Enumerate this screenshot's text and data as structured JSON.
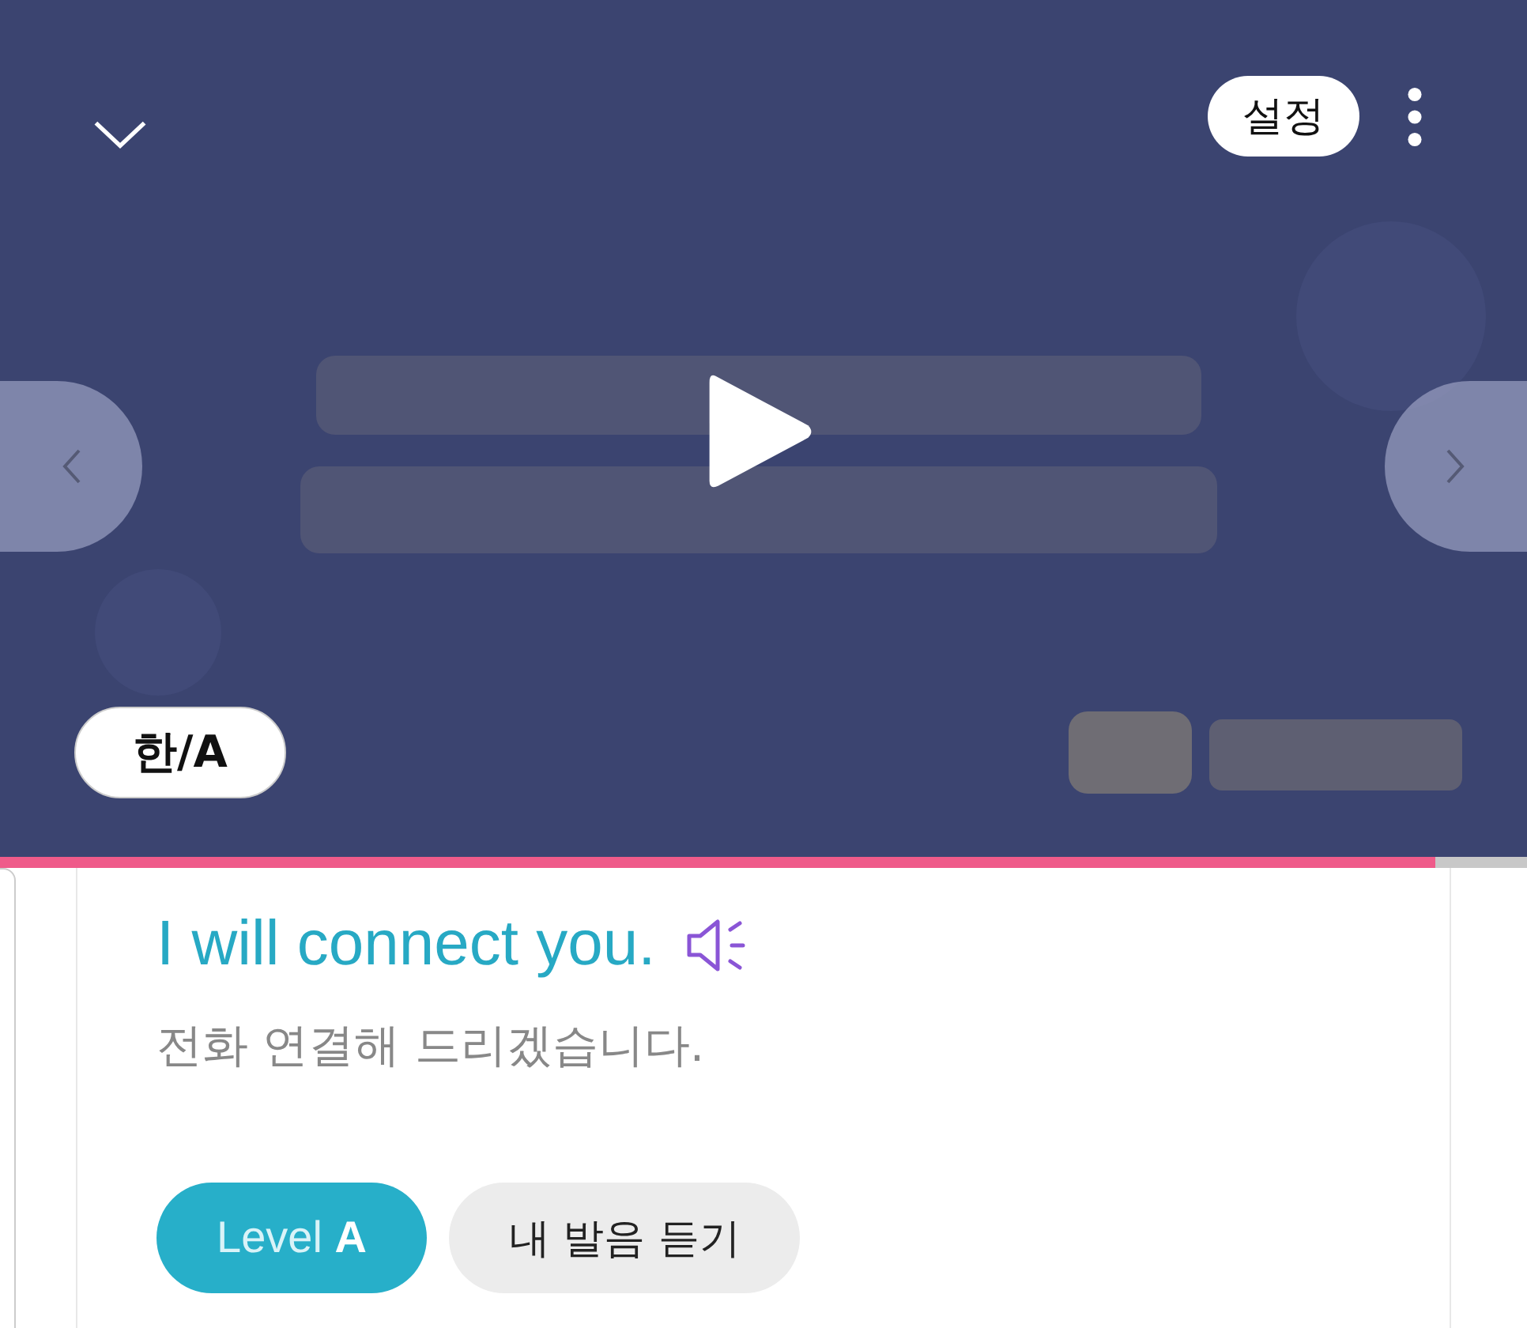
{
  "player": {
    "settings_tooltip": "설정",
    "language_toggle": "한/A",
    "progress": {
      "level": 0.94
    }
  },
  "card": {
    "sentence": "I will connect you.",
    "translation": "전화 연결해 드리겠습니다.",
    "buttons": [
      {
        "label": "Level **A**",
        "kind": "level"
      },
      {
        "label": "내 발음 듣기",
        "kind": "record"
      }
    ]
  }
}
